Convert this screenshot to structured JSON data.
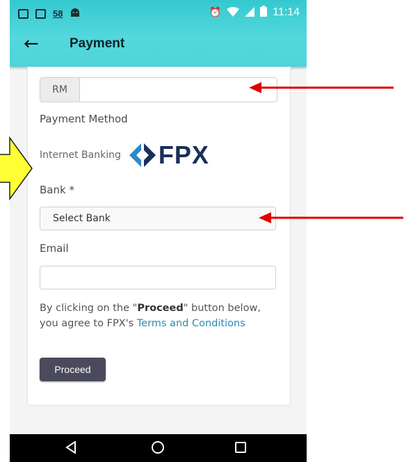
{
  "status_bar": {
    "notification_count": "58",
    "time": "11:14",
    "icons": [
      "message-icon",
      "image-icon",
      "android-icon",
      "alarm-icon",
      "wifi-icon",
      "signal-icon",
      "battery-icon"
    ]
  },
  "app_bar": {
    "title": "Payment",
    "back_icon": "arrow-left-icon"
  },
  "form": {
    "amount_prefix": "RM",
    "amount_value": "",
    "payment_method_label": "Payment Method",
    "payment_option_label": "Internet Banking",
    "payment_logo_text": "FPX",
    "bank_label": "Bank *",
    "bank_select_value": "Select Bank",
    "email_label": "Email",
    "email_value": "",
    "terms_prefix": "By clicking on the \"",
    "terms_button_name": "Proceed",
    "terms_middle": "\" button below, you agree to FPX's ",
    "terms_link": "Terms and Conditions",
    "proceed_label": "Proceed"
  },
  "annotations": {
    "arrow_color": "#e00000",
    "highlight_arrow_color": "#ffff33"
  },
  "colors": {
    "header_teal": "#4fd3d8",
    "fpx_navy": "#1a2e57",
    "fpx_blue": "#2f87c9",
    "button_dark": "#4a4a5c",
    "link_blue": "#2a8ab5"
  }
}
